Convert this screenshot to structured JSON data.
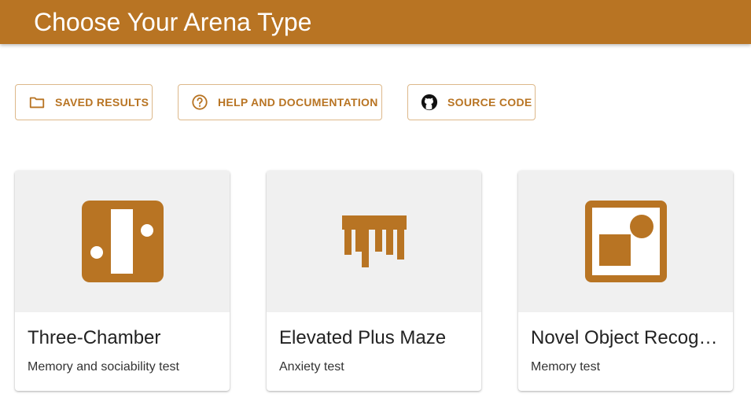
{
  "header": {
    "title": "Choose Your Arena Type",
    "color": "#b87423"
  },
  "toolbar": {
    "buttons": [
      {
        "label": "SAVED RESULTS",
        "icon": "folder-icon"
      },
      {
        "label": "HELP AND DOCUMENTATION",
        "icon": "help-circle-icon"
      },
      {
        "label": "SOURCE CODE",
        "icon": "github-icon"
      }
    ]
  },
  "arenas": [
    {
      "title": "Three-Chamber",
      "subtitle": "Memory and sociability test",
      "icon": "three-chamber-icon"
    },
    {
      "title": "Elevated Plus Maze",
      "subtitle": "Anxiety test",
      "icon": "elevated-plus-maze-icon"
    },
    {
      "title": "Novel Object Recognition",
      "subtitle": "Memory test",
      "icon": "novel-object-recognition-icon"
    }
  ]
}
